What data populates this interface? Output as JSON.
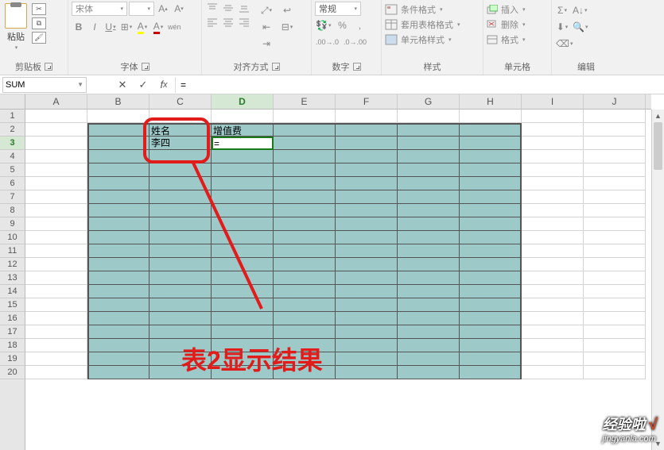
{
  "ribbon": {
    "clipboard": {
      "label": "剪贴板",
      "paste": "粘贴"
    },
    "font": {
      "label": "字体",
      "name": "宋体",
      "size": "",
      "bold": "B",
      "italic": "I",
      "underline": "U",
      "wen": "wén"
    },
    "alignment": {
      "label": "对齐方式"
    },
    "number": {
      "label": "数字",
      "format": "常规",
      "percent": "%",
      "comma": ","
    },
    "styles": {
      "label": "样式",
      "cond": "条件格式",
      "table": "套用表格格式",
      "cell": "单元格样式"
    },
    "cells": {
      "label": "单元格",
      "insert": "插入",
      "delete": "删除",
      "format": "格式"
    },
    "editing": {
      "label": "编辑",
      "sigma": "Σ"
    }
  },
  "namebox": "SUM",
  "formula": "=",
  "columns": [
    "A",
    "B",
    "C",
    "D",
    "E",
    "F",
    "G",
    "H",
    "I",
    "J"
  ],
  "rows": [
    "1",
    "2",
    "3",
    "4",
    "5",
    "6",
    "7",
    "8",
    "9",
    "10",
    "11",
    "12",
    "13",
    "14",
    "15",
    "16",
    "17",
    "18",
    "19",
    "20"
  ],
  "activeCol": 3,
  "activeRow": 2,
  "cellC2": "姓名",
  "cellD2": "增值费",
  "cellC3": "李四",
  "cellD3": "=",
  "annotation_text": "表2显示结果",
  "watermark": {
    "top": "经验啦",
    "check": "√",
    "bottom": "jingyanla.com"
  }
}
